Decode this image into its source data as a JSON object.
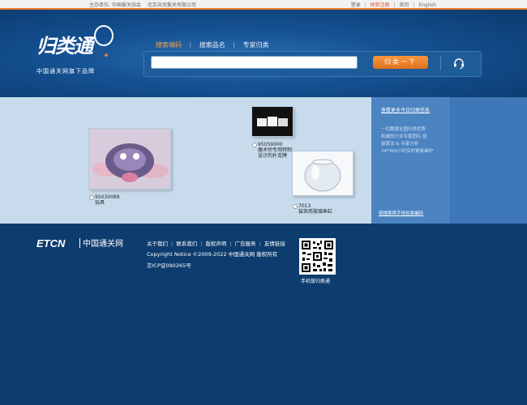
{
  "topbar": {
    "sponsor": "主办单位: 中国报关协会",
    "company": "北京自贸报关有限公司",
    "login": "登录",
    "register": "体验注册",
    "home": "首页",
    "english": "English"
  },
  "logo": {
    "name": "归类通",
    "tagline": "中国通关网旗下品牌"
  },
  "search": {
    "tabs": [
      "搜索编码",
      "搜索品名",
      "专家归类"
    ],
    "active_tab": 0,
    "input_value": "",
    "button_label": "归类一下",
    "support_icon": "headset-icon"
  },
  "products": [
    {
      "code": "95030089",
      "name": "玩具"
    },
    {
      "code": "95059000",
      "name": "魔术师专用特制设计的扑克牌"
    },
    {
      "code": "7013",
      "name": "装饰用玻璃鱼缸"
    }
  ],
  "sidebar": {
    "title": "查看更多今日归类信息",
    "lines": [
      "一切数据全国归类优势",
      "权威的行业专家团队 智",
      "能算法 & 专家分析",
      "24*365小时实时更新维护"
    ],
    "bottom_link": "按搜索首字母检索编码"
  },
  "footer": {
    "brand": "ETCN",
    "brand_cn": "中国通关网",
    "links": [
      "关于我们",
      "联系我们",
      "版权声明",
      "广告服务",
      "友情链接"
    ],
    "copyright": "Copyright Notice ©2009-2022 中国通关网 版权所有",
    "icp": "京ICP证090265号",
    "qr_caption": "手机版归类通"
  },
  "colors": {
    "accent_orange": "#e87a2b",
    "header_blue": "#155294",
    "background_blue": "#0d3c6e",
    "band_light": "#c7dbec",
    "sidebar_blue": "#3f78b8"
  }
}
